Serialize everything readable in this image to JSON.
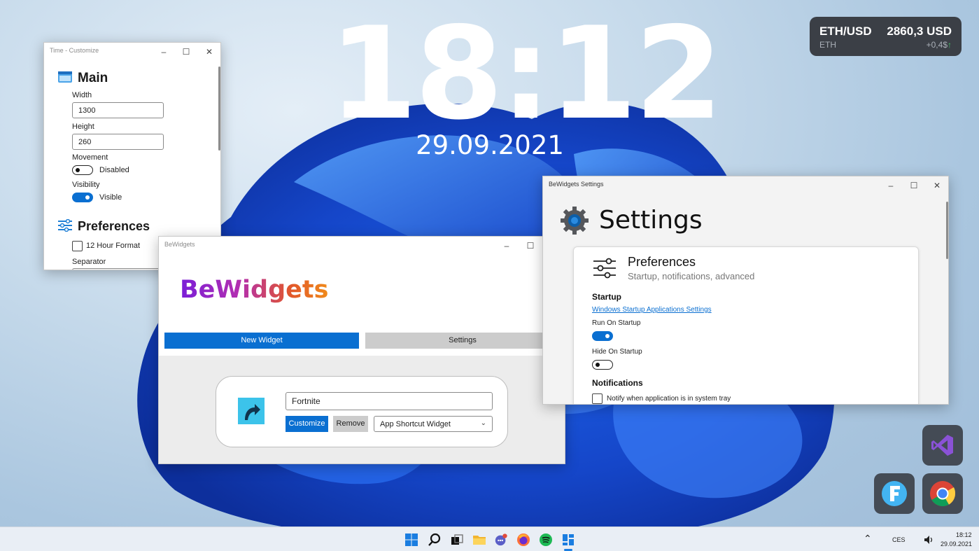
{
  "clock": {
    "time": "18:12",
    "date": "29.09.2021"
  },
  "crypto": {
    "pair": "ETH/USD",
    "price": "2860,3 USD",
    "symbol": "ETH",
    "change": "+0,4$",
    "change_arrow": "↑",
    "bg": "#3b3f46",
    "up_color": "#46c46a"
  },
  "time_customize": {
    "title": "Time - Customize",
    "main_heading": "Main",
    "width_label": "Width",
    "width_value": "1300",
    "height_label": "Height",
    "height_value": "260",
    "movement_label": "Movement",
    "movement_state": "Disabled",
    "visibility_label": "Visibility",
    "visibility_state": "Visible",
    "preferences_heading": "Preferences",
    "twelve_hour_label": "12 Hour Format",
    "separator_label": "Separator"
  },
  "bewidgets": {
    "title": "BeWidgets",
    "logo": "BeWidgets",
    "new_widget_label": "New Widget",
    "settings_label": "Settings",
    "widget": {
      "name_value": "Fortnite",
      "customize_label": "Customize",
      "remove_label": "Remove",
      "type_value": "App Shortcut Widget",
      "icon": "shortcut-arrow-icon"
    }
  },
  "settings_window": {
    "title": "BeWidgets Settings",
    "heading": "Settings",
    "section_title": "Preferences",
    "section_subtitle": "Startup, notifications, advanced",
    "startup_heading": "Startup",
    "startup_link": "Windows Startup Applications Settings",
    "run_on_startup_label": "Run On Startup",
    "hide_on_startup_label": "Hide On Startup",
    "notifications_heading": "Notifications",
    "notify_tray_label": "Notify when application is in system tray"
  },
  "dock": {
    "apps": [
      "visual-studio-icon",
      "f-app-icon",
      "chrome-icon"
    ]
  },
  "taskbar": {
    "icons": [
      "start-icon",
      "search-icon",
      "task-view-icon",
      "file-explorer-icon",
      "chat-icon",
      "firefox-icon",
      "spotify-icon",
      "bewidgets-icon"
    ],
    "tray_language": "CES",
    "tray_time": "18:12",
    "tray_date": "29.09.2021"
  },
  "colors": {
    "accent": "#0a6fd1",
    "taskbar_bg": "#e9eef5"
  }
}
